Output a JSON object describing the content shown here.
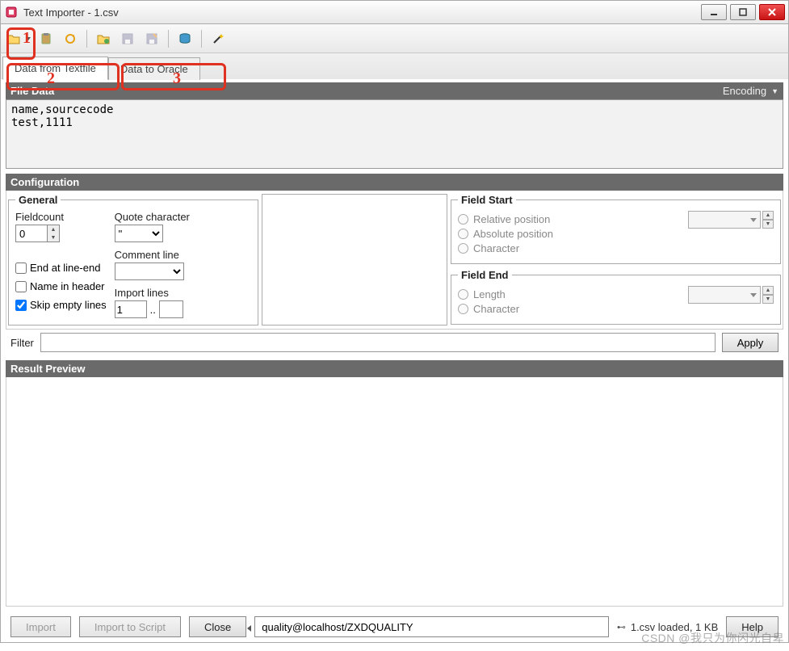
{
  "window": {
    "title": "Text Importer - 1.csv"
  },
  "tabs": {
    "textfile": "Data from Textfile",
    "oracle": "Data to Oracle"
  },
  "filedata": {
    "header": "File Data",
    "encoding_label": "Encoding",
    "content": "name,sourcecode\ntest,1111"
  },
  "config": {
    "header": "Configuration",
    "general": {
      "legend": "General",
      "fieldcount_label": "Fieldcount",
      "fieldcount_value": "0",
      "end_at_line_end": "End at line-end",
      "name_in_header": "Name in header",
      "skip_empty": "Skip empty lines",
      "quote_label": "Quote character",
      "quote_value": "\"",
      "comment_label": "Comment line",
      "import_lines_label": "Import lines",
      "import_lines_value": "1",
      "import_dots": ".."
    },
    "field_start": {
      "legend": "Field Start",
      "relative": "Relative position",
      "absolute": "Absolute position",
      "character": "Character"
    },
    "field_end": {
      "legend": "Field End",
      "length": "Length",
      "character": "Character"
    }
  },
  "filter": {
    "label": "Filter",
    "apply": "Apply"
  },
  "result": {
    "header": "Result Preview"
  },
  "buttons": {
    "import": "Import",
    "import_script": "Import to Script",
    "close": "Close",
    "help": "Help"
  },
  "status": {
    "connection": "quality@localhost/ZXDQUALITY",
    "file": "1.csv loaded,  1 KB"
  },
  "annotations": {
    "a1": "1",
    "a2": "2",
    "a3": "3"
  },
  "watermark": "CSDN @我只为你闪光自卑"
}
